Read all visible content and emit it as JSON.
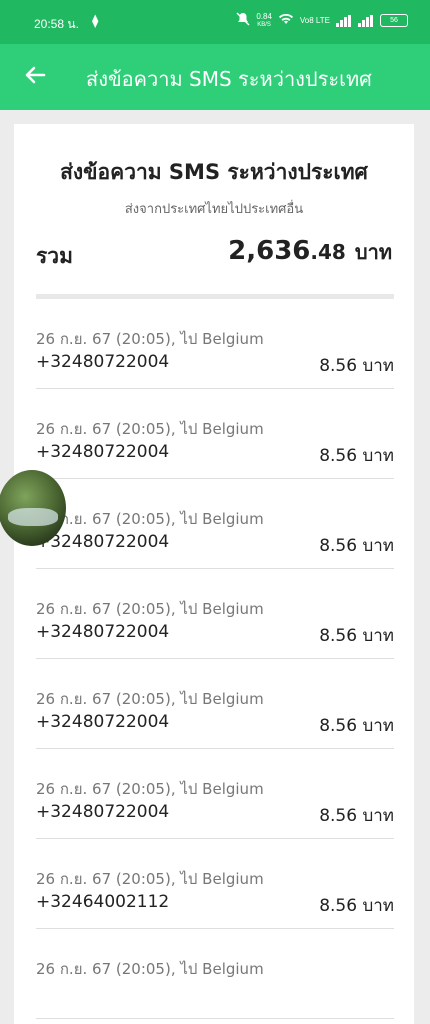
{
  "status": {
    "time": "20:58 น.",
    "net_speed": "0.84",
    "net_unit": "KB/S",
    "volte": "Vo8 LTE",
    "battery": "56"
  },
  "appbar": {
    "title": "ส่งข้อความ SMS ระหว่างประเทศ"
  },
  "card": {
    "title": "ส่งข้อความ SMS ระหว่างประเทศ",
    "subtitle": "ส่งจากประเทศไทยไปประเทศอื่น",
    "total_label": "รวม",
    "total_main": "2,636",
    "total_cents": ".48",
    "total_unit": "บาท"
  },
  "items": [
    {
      "meta": "26 ก.ย. 67 (20:05), ไป Belgium",
      "phone": "+32480722004",
      "amount": "8.56 บาท"
    },
    {
      "meta": "26 ก.ย. 67 (20:05), ไป Belgium",
      "phone": "+32480722004",
      "amount": "8.56 บาท"
    },
    {
      "meta": "26 ก.ย. 67 (20:05), ไป Belgium",
      "phone": "+32480722004",
      "amount": "8.56 บาท"
    },
    {
      "meta": "26 ก.ย. 67 (20:05), ไป Belgium",
      "phone": "+32480722004",
      "amount": "8.56 บาท"
    },
    {
      "meta": "26 ก.ย. 67 (20:05), ไป Belgium",
      "phone": "+32480722004",
      "amount": "8.56 บาท"
    },
    {
      "meta": "26 ก.ย. 67 (20:05), ไป Belgium",
      "phone": "+32480722004",
      "amount": "8.56 บาท"
    },
    {
      "meta": "26 ก.ย. 67 (20:05), ไป Belgium",
      "phone": "+32464002112",
      "amount": "8.56 บาท"
    },
    {
      "meta": "26 ก.ย. 67 (20:05), ไป Belgium",
      "phone": "",
      "amount": ""
    }
  ],
  "colors": {
    "statusbar": "#21b862",
    "appbar": "#2ecf78"
  },
  "icons": {
    "back": "arrow-left-icon",
    "mute": "bell-off-icon",
    "wifi": "wifi-icon",
    "signal": "signal-icon",
    "battery": "battery-icon"
  }
}
